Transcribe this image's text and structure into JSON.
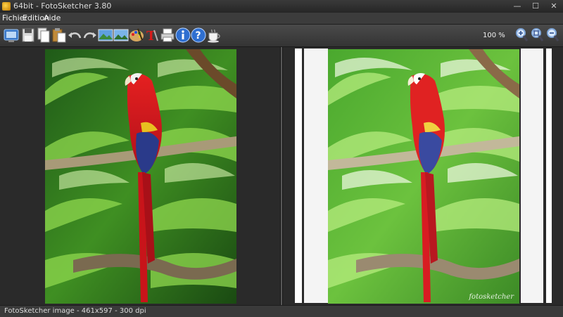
{
  "window": {
    "title": "64bit - FotoSketcher 3.80",
    "minimize": "—",
    "maximize": "☐",
    "close": "✕"
  },
  "menu": {
    "items": [
      "Fichier",
      "Edition",
      "Aide"
    ]
  },
  "toolbar": {
    "zoom_label": "100 %"
  },
  "canvas": {
    "signature": "fotosketcher"
  },
  "status": {
    "text": "FotoSketcher image - 461x597 - 300 dpi"
  },
  "colors": {
    "accent": "#1e90ff",
    "parrot_red": "#d81a1a",
    "parrot_blue": "#2a3a8a"
  }
}
